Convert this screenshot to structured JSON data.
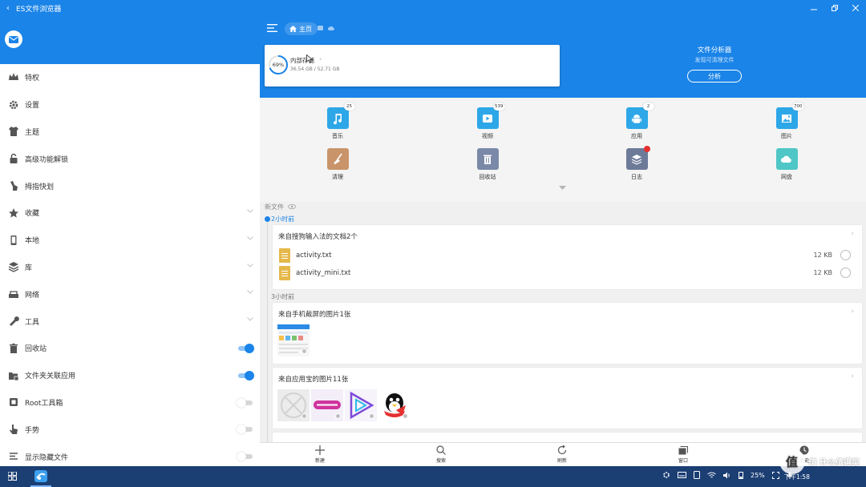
{
  "window": {
    "title": "ES文件浏览器"
  },
  "sidebar": {
    "items": [
      {
        "label": "特权",
        "icon": "crown-icon"
      },
      {
        "label": "设置",
        "icon": "gear-icon"
      },
      {
        "label": "主题",
        "icon": "shirt-icon"
      },
      {
        "label": "高级功能解锁",
        "icon": "lock-icon"
      },
      {
        "label": "拇指快划",
        "icon": "thumb-swipe-icon"
      },
      {
        "label": "收藏",
        "icon": "star-icon",
        "expandable": true
      },
      {
        "label": "本地",
        "icon": "phone-icon",
        "expandable": true
      },
      {
        "label": "库",
        "icon": "library-icon",
        "expandable": true
      },
      {
        "label": "网络",
        "icon": "network-icon",
        "expandable": true
      },
      {
        "label": "工具",
        "icon": "wrench-icon",
        "expandable": true
      },
      {
        "label": "回收站",
        "icon": "trash-icon",
        "toggle": true,
        "on": true
      },
      {
        "label": "文件夹关联应用",
        "icon": "folder-app-icon",
        "toggle": true,
        "on": true
      },
      {
        "label": "Root工具箱",
        "icon": "root-icon",
        "toggle": true,
        "on": false
      },
      {
        "label": "手势",
        "icon": "gesture-icon",
        "toggle": true,
        "on": false
      },
      {
        "label": "显示隐藏文件",
        "icon": "hidden-files-icon",
        "toggle": true,
        "on": false
      }
    ]
  },
  "header": {
    "breadcrumb": "主页"
  },
  "storage": {
    "percent": "69%",
    "name": "内部存储",
    "size": "36.54 GB / 52.71 GB",
    "used_fraction": 0.69
  },
  "analyzer": {
    "title": "文件分析器",
    "subtitle": "发现可清理文件",
    "button": "分析"
  },
  "categories": [
    {
      "label": "音乐",
      "badge": "25",
      "color": "#2da7e8",
      "icon": "music-icon"
    },
    {
      "label": "视频",
      "badge": "539",
      "color": "#2da7e8",
      "icon": "video-icon"
    },
    {
      "label": "应用",
      "badge": "2",
      "color": "#2da7e8",
      "icon": "android-icon"
    },
    {
      "label": "图片",
      "badge": "700",
      "color": "#2da7e8",
      "icon": "image-icon"
    },
    {
      "label": "清理",
      "badge": "",
      "color": "#c9946a",
      "icon": "broom-icon"
    },
    {
      "label": "回收站",
      "badge": "",
      "color": "#7b89a8",
      "icon": "trash-icon"
    },
    {
      "label": "日志",
      "badge": "",
      "color": "#6d7b99",
      "icon": "log-icon"
    },
    {
      "label": "网盘",
      "badge": "",
      "color": "#4fc7c6",
      "icon": "cloud-icon"
    }
  ],
  "new_files": {
    "title": "新文件",
    "groups": [
      {
        "time": "2小时前",
        "card_title": "来自搜狗输入法的文档2个",
        "files": [
          {
            "name": "activity.txt",
            "size": "12 KB"
          },
          {
            "name": "activity_mini.txt",
            "size": "12 KB"
          }
        ]
      },
      {
        "time": "3小时前",
        "card_title": "来自手机截屏的图片1张"
      },
      {
        "card_title": "来自应用宝的图片11张"
      }
    ]
  },
  "bottom_nav": [
    {
      "label": "新建",
      "icon": "plus-icon"
    },
    {
      "label": "搜索",
      "icon": "search-icon"
    },
    {
      "label": "刷新",
      "icon": "refresh-icon"
    },
    {
      "label": "窗口",
      "icon": "windows-icon"
    },
    {
      "label": "历史",
      "icon": "clock-icon"
    }
  ],
  "taskbar": {
    "battery": "25%",
    "time": "下午1:58"
  },
  "watermark": {
    "text": "值 什么值得买",
    "glyph": "值"
  }
}
